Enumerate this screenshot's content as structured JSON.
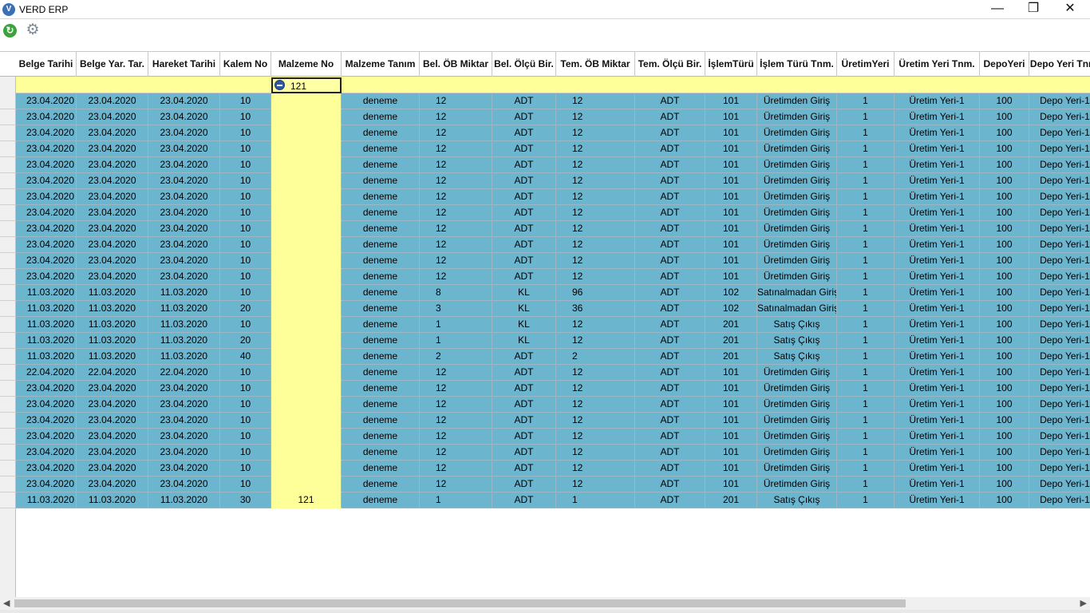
{
  "window": {
    "title": "VERD ERP",
    "app_icon_glyph": "V",
    "minimize_glyph": "—",
    "maximize_glyph": "❐",
    "close_glyph": "✕"
  },
  "toolbar": {
    "refresh_glyph": "↻",
    "settings_glyph": "⚙"
  },
  "grid": {
    "columns": [
      "Belge Tarihi",
      "Belge Yar. Tar.",
      "Hareket Tarihi",
      "Kalem No",
      "Malzeme No",
      "Malzeme Tanım",
      "Bel. ÖB Miktar",
      "Bel. Ölçü Bir.",
      "Tem. ÖB Miktar",
      "Tem. Ölçü Bir.",
      "İşlemTürü",
      "İşlem Türü Tnm.",
      "ÜretimYeri",
      "Üretim Yeri Tnm.",
      "DepoYeri",
      "Depo Yeri Tnm."
    ],
    "filter": {
      "column": "Malzeme No",
      "value": "121"
    },
    "rows": [
      [
        "23.04.2020",
        "23.04.2020",
        "23.04.2020",
        "10",
        "",
        "deneme",
        "12",
        "ADT",
        "12",
        "ADT",
        "101",
        "Üretimden Giriş",
        "1",
        "Üretim Yeri-1",
        "100",
        "Depo Yeri-1"
      ],
      [
        "23.04.2020",
        "23.04.2020",
        "23.04.2020",
        "10",
        "",
        "deneme",
        "12",
        "ADT",
        "12",
        "ADT",
        "101",
        "Üretimden Giriş",
        "1",
        "Üretim Yeri-1",
        "100",
        "Depo Yeri-1"
      ],
      [
        "23.04.2020",
        "23.04.2020",
        "23.04.2020",
        "10",
        "",
        "deneme",
        "12",
        "ADT",
        "12",
        "ADT",
        "101",
        "Üretimden Giriş",
        "1",
        "Üretim Yeri-1",
        "100",
        "Depo Yeri-1"
      ],
      [
        "23.04.2020",
        "23.04.2020",
        "23.04.2020",
        "10",
        "",
        "deneme",
        "12",
        "ADT",
        "12",
        "ADT",
        "101",
        "Üretimden Giriş",
        "1",
        "Üretim Yeri-1",
        "100",
        "Depo Yeri-1"
      ],
      [
        "23.04.2020",
        "23.04.2020",
        "23.04.2020",
        "10",
        "",
        "deneme",
        "12",
        "ADT",
        "12",
        "ADT",
        "101",
        "Üretimden Giriş",
        "1",
        "Üretim Yeri-1",
        "100",
        "Depo Yeri-1"
      ],
      [
        "23.04.2020",
        "23.04.2020",
        "23.04.2020",
        "10",
        "",
        "deneme",
        "12",
        "ADT",
        "12",
        "ADT",
        "101",
        "Üretimden Giriş",
        "1",
        "Üretim Yeri-1",
        "100",
        "Depo Yeri-1"
      ],
      [
        "23.04.2020",
        "23.04.2020",
        "23.04.2020",
        "10",
        "",
        "deneme",
        "12",
        "ADT",
        "12",
        "ADT",
        "101",
        "Üretimden Giriş",
        "1",
        "Üretim Yeri-1",
        "100",
        "Depo Yeri-1"
      ],
      [
        "23.04.2020",
        "23.04.2020",
        "23.04.2020",
        "10",
        "",
        "deneme",
        "12",
        "ADT",
        "12",
        "ADT",
        "101",
        "Üretimden Giriş",
        "1",
        "Üretim Yeri-1",
        "100",
        "Depo Yeri-1"
      ],
      [
        "23.04.2020",
        "23.04.2020",
        "23.04.2020",
        "10",
        "",
        "deneme",
        "12",
        "ADT",
        "12",
        "ADT",
        "101",
        "Üretimden Giriş",
        "1",
        "Üretim Yeri-1",
        "100",
        "Depo Yeri-1"
      ],
      [
        "23.04.2020",
        "23.04.2020",
        "23.04.2020",
        "10",
        "",
        "deneme",
        "12",
        "ADT",
        "12",
        "ADT",
        "101",
        "Üretimden Giriş",
        "1",
        "Üretim Yeri-1",
        "100",
        "Depo Yeri-1"
      ],
      [
        "23.04.2020",
        "23.04.2020",
        "23.04.2020",
        "10",
        "",
        "deneme",
        "12",
        "ADT",
        "12",
        "ADT",
        "101",
        "Üretimden Giriş",
        "1",
        "Üretim Yeri-1",
        "100",
        "Depo Yeri-1"
      ],
      [
        "23.04.2020",
        "23.04.2020",
        "23.04.2020",
        "10",
        "",
        "deneme",
        "12",
        "ADT",
        "12",
        "ADT",
        "101",
        "Üretimden Giriş",
        "1",
        "Üretim Yeri-1",
        "100",
        "Depo Yeri-1"
      ],
      [
        "11.03.2020",
        "11.03.2020",
        "11.03.2020",
        "10",
        "",
        "deneme",
        "8",
        "KL",
        "96",
        "ADT",
        "102",
        "Satınalmadan Giriş",
        "1",
        "Üretim Yeri-1",
        "100",
        "Depo Yeri-1"
      ],
      [
        "11.03.2020",
        "11.03.2020",
        "11.03.2020",
        "20",
        "",
        "deneme",
        "3",
        "KL",
        "36",
        "ADT",
        "102",
        "Satınalmadan Giriş",
        "1",
        "Üretim Yeri-1",
        "100",
        "Depo Yeri-1"
      ],
      [
        "11.03.2020",
        "11.03.2020",
        "11.03.2020",
        "10",
        "",
        "deneme",
        "1",
        "KL",
        "12",
        "ADT",
        "201",
        "Satış Çıkış",
        "1",
        "Üretim Yeri-1",
        "100",
        "Depo Yeri-1"
      ],
      [
        "11.03.2020",
        "11.03.2020",
        "11.03.2020",
        "20",
        "",
        "deneme",
        "1",
        "KL",
        "12",
        "ADT",
        "201",
        "Satış Çıkış",
        "1",
        "Üretim Yeri-1",
        "100",
        "Depo Yeri-1"
      ],
      [
        "11.03.2020",
        "11.03.2020",
        "11.03.2020",
        "40",
        "",
        "deneme",
        "2",
        "ADT",
        "2",
        "ADT",
        "201",
        "Satış Çıkış",
        "1",
        "Üretim Yeri-1",
        "100",
        "Depo Yeri-1"
      ],
      [
        "22.04.2020",
        "22.04.2020",
        "22.04.2020",
        "10",
        "",
        "deneme",
        "12",
        "ADT",
        "12",
        "ADT",
        "101",
        "Üretimden Giriş",
        "1",
        "Üretim Yeri-1",
        "100",
        "Depo Yeri-1"
      ],
      [
        "23.04.2020",
        "23.04.2020",
        "23.04.2020",
        "10",
        "",
        "deneme",
        "12",
        "ADT",
        "12",
        "ADT",
        "101",
        "Üretimden Giriş",
        "1",
        "Üretim Yeri-1",
        "100",
        "Depo Yeri-1"
      ],
      [
        "23.04.2020",
        "23.04.2020",
        "23.04.2020",
        "10",
        "",
        "deneme",
        "12",
        "ADT",
        "12",
        "ADT",
        "101",
        "Üretimden Giriş",
        "1",
        "Üretim Yeri-1",
        "100",
        "Depo Yeri-1"
      ],
      [
        "23.04.2020",
        "23.04.2020",
        "23.04.2020",
        "10",
        "",
        "deneme",
        "12",
        "ADT",
        "12",
        "ADT",
        "101",
        "Üretimden Giriş",
        "1",
        "Üretim Yeri-1",
        "100",
        "Depo Yeri-1"
      ],
      [
        "23.04.2020",
        "23.04.2020",
        "23.04.2020",
        "10",
        "",
        "deneme",
        "12",
        "ADT",
        "12",
        "ADT",
        "101",
        "Üretimden Giriş",
        "1",
        "Üretim Yeri-1",
        "100",
        "Depo Yeri-1"
      ],
      [
        "23.04.2020",
        "23.04.2020",
        "23.04.2020",
        "10",
        "",
        "deneme",
        "12",
        "ADT",
        "12",
        "ADT",
        "101",
        "Üretimden Giriş",
        "1",
        "Üretim Yeri-1",
        "100",
        "Depo Yeri-1"
      ],
      [
        "23.04.2020",
        "23.04.2020",
        "23.04.2020",
        "10",
        "",
        "deneme",
        "12",
        "ADT",
        "12",
        "ADT",
        "101",
        "Üretimden Giriş",
        "1",
        "Üretim Yeri-1",
        "100",
        "Depo Yeri-1"
      ],
      [
        "23.04.2020",
        "23.04.2020",
        "23.04.2020",
        "10",
        "",
        "deneme",
        "12",
        "ADT",
        "12",
        "ADT",
        "101",
        "Üretimden Giriş",
        "1",
        "Üretim Yeri-1",
        "100",
        "Depo Yeri-1"
      ],
      [
        "11.03.2020",
        "11.03.2020",
        "11.03.2020",
        "30",
        "121",
        "deneme",
        "1",
        "ADT",
        "1",
        "ADT",
        "201",
        "Satış Çıkış",
        "1",
        "Üretim Yeri-1",
        "100",
        "Depo Yeri-1"
      ]
    ]
  },
  "scrollbar": {
    "left_glyph": "◀",
    "right_glyph": "▶"
  },
  "colors": {
    "row_bg": "#6cb5cf",
    "highlight_column": "#ffff99"
  }
}
